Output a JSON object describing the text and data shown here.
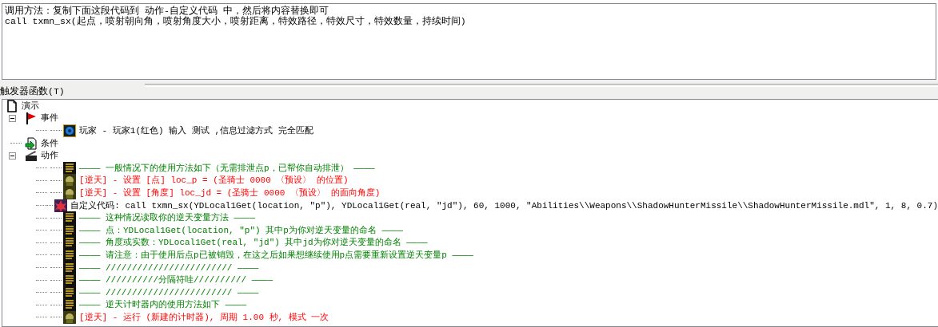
{
  "description_box": {
    "lines": [
      "调用方法：复制下面这段代码到 动作-自定义代码 中，然后将内容替换即可",
      "call txmn_sx(起点，喷射朝向角，喷射角度大小，喷射距离，特效路径，特效尺寸，特效数量，持续时间)"
    ]
  },
  "panel": {
    "label": "触发器函数(T)"
  },
  "tree": [
    {
      "kind": "trigger",
      "label": "演示",
      "children": [
        {
          "kind": "events",
          "label": "事件",
          "expanded": true,
          "children": [
            {
              "kind": "event",
              "label": "玩家 - 玩家1(红色) 输入 测试 ,信息过滤方式 完全匹配"
            }
          ]
        },
        {
          "kind": "conditions",
          "label": "条件"
        },
        {
          "kind": "actions",
          "label": "动作",
          "expanded": true,
          "children": [
            {
              "kind": "comment",
              "label": "———— 一般情况下的使用方法如下（无需排泄点p，已帮你自动排泄） ————"
            },
            {
              "kind": "set",
              "label": "[逆天] - 设置 [点] loc_p = (圣骑士 0000 〈预设〉 的位置)"
            },
            {
              "kind": "set",
              "label": "[逆天] - 设置 [角度] loc_jd = (圣骑士 0000 〈预设〉 的面向角度)"
            },
            {
              "kind": "custom",
              "label": "自定义代码:   call txmn_sx(YDLocal1Get(location, \"p\"), YDLocal1Get(real, \"jd\"), 60, 1000, \"Abilities\\\\Weapons\\\\ShadowHunterMissile\\\\ShadowHunterMissile.mdl\", 1, 8, 0.7)"
            },
            {
              "kind": "comment",
              "label": "———— 这种情况读取你的逆天变量方法 ————"
            },
            {
              "kind": "comment",
              "label": "———— 点：YDLocal1Get(location, \"p\")   其中p为你对逆天变量的命名 ————"
            },
            {
              "kind": "comment",
              "label": "———— 角度或实数：YDLocal1Get(real, \"jd\")   其中jd为你对逆天变量的命名 ————"
            },
            {
              "kind": "comment",
              "label": "———— 请注意：由于使用后点p已被销毁，在这之后如果想继续使用p点需要重新设置逆天变量p ————"
            },
            {
              "kind": "comment",
              "label": "———— //////////////////////// ————"
            },
            {
              "kind": "comment",
              "label": "———— //////////分隔符哇////////// ————"
            },
            {
              "kind": "comment",
              "label": "———— //////////////////////// ————"
            },
            {
              "kind": "comment",
              "label": "———— 逆天计时器内的使用方法如下 ————"
            },
            {
              "kind": "set",
              "label": "[逆天] - 运行 (新建的计时器), 周期 1.00 秒, 模式 一次"
            }
          ]
        }
      ]
    }
  ]
}
